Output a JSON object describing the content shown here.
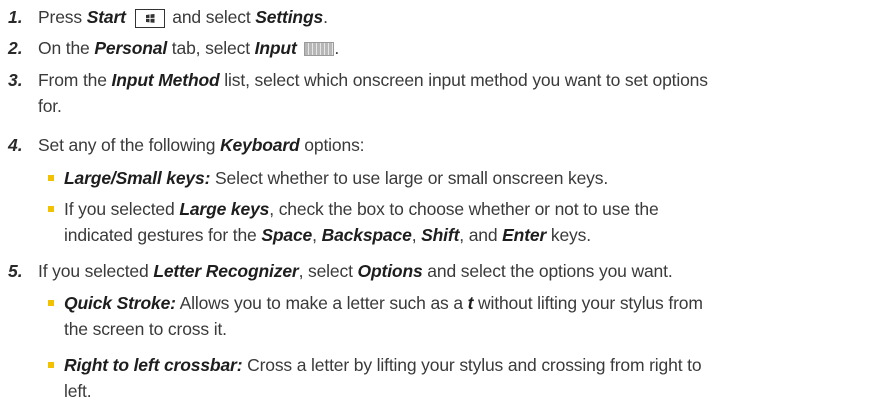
{
  "steps": [
    {
      "num": "1.",
      "parts": [
        "Press ",
        "Start",
        " ",
        " and select ",
        "Settings",
        "."
      ]
    },
    {
      "num": "2.",
      "parts": [
        "On the ",
        "Personal",
        " tab, select ",
        "Input",
        " "
      ]
    },
    {
      "num": "3.",
      "parts": [
        "From the ",
        "Input Method",
        " list, select which onscreen input method you want to set options",
        "for."
      ]
    },
    {
      "num": "4.",
      "parts": [
        "Set any of the following ",
        "Keyboard",
        " options:"
      ],
      "bullets": [
        [
          "Large/Small keys:",
          " Select whether to use large or small onscreen keys."
        ],
        [
          "If you selected ",
          "Large keys",
          ", check the box to choose whether or not to use the",
          "indicated gestures for the ",
          "Space",
          ", ",
          "Backspace",
          ", ",
          "Shift",
          ", and ",
          "Enter",
          " keys."
        ]
      ]
    },
    {
      "num": "5.",
      "parts": [
        "If you selected ",
        "Letter Recognizer",
        ", select ",
        "Options",
        " and select the options you want."
      ],
      "bullets": [
        [
          "Quick Stroke:",
          " Allows you to make a letter such as a ",
          "t",
          " without lifting your stylus from",
          "the screen to cross it."
        ],
        [
          "Right to left crossbar:",
          " Cross a letter by lifting your stylus and crossing from right to",
          "left."
        ]
      ]
    }
  ],
  "icons": {
    "start_key": "windows-start-key-icon",
    "input": "keyboard-input-icon"
  },
  "colors": {
    "bullet": "#f2c200",
    "text": "#3a3a3a"
  }
}
